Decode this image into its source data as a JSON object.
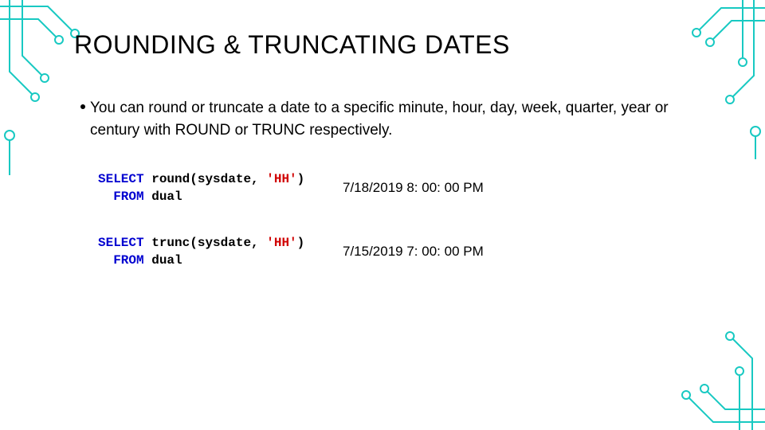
{
  "title": "ROUNDING & TRUNCATING DATES",
  "bullet": "You can round or truncate a date to a specific minute, hour, day, week, quarter, year or century with ROUND or TRUNC respectively.",
  "examples": [
    {
      "code": {
        "kw1": "SELECT",
        "fn": "round",
        "args": "(sysdate, ",
        "lit": "'HH'",
        "close": ")",
        "kw2": "  FROM",
        "tbl": "dual"
      },
      "output": "7/18/2019 8: 00: 00 PM"
    },
    {
      "code": {
        "kw1": "SELECT",
        "fn": "trunc",
        "args": "(sysdate, ",
        "lit": "'HH'",
        "close": ")",
        "kw2": "  FROM",
        "tbl": "dual"
      },
      "output": "7/15/2019 7: 00: 00 PM"
    }
  ],
  "decor_color": "#18c9c2"
}
